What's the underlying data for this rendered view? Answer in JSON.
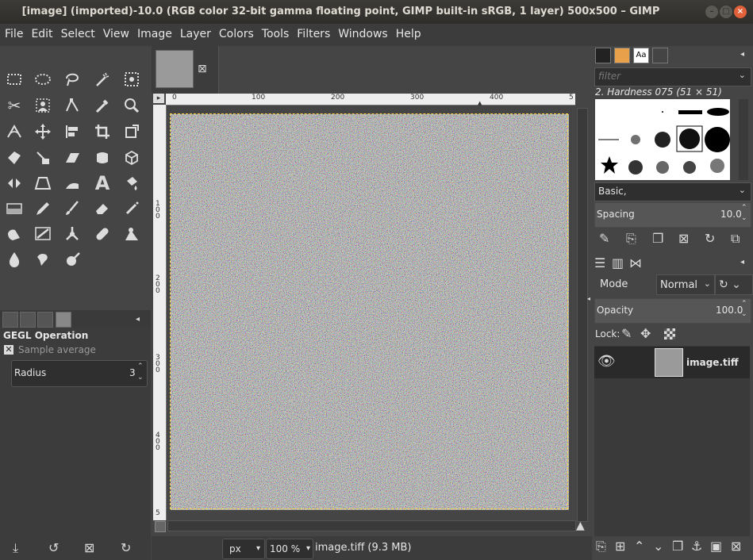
{
  "window": {
    "title": "[image] (imported)-10.0 (RGB color 32-bit gamma floating point, GIMP built-in sRGB, 1 layer) 500x500 – GIMP"
  },
  "menu": [
    "File",
    "Edit",
    "Select",
    "View",
    "Image",
    "Layer",
    "Colors",
    "Tools",
    "Filters",
    "Windows",
    "Help"
  ],
  "tool_options": {
    "title": "GEGL Operation",
    "sample_average_label": "Sample average",
    "radius_label": "Radius",
    "radius_value": "3"
  },
  "rulers": {
    "h_ticks": [
      "0",
      "100",
      "200",
      "300",
      "400",
      "5"
    ],
    "v_ticks": [
      "1",
      "0",
      "0",
      "2",
      "0",
      "0",
      "3",
      "0",
      "0",
      "4",
      "0",
      "0",
      "5"
    ]
  },
  "status": {
    "unit": "px",
    "zoom": "100 %",
    "file_info": "image.tiff (9.3 MB)"
  },
  "brushes": {
    "filter_placeholder": "filter",
    "selected_brush": "2. Hardness 075 (51 × 51)",
    "tag_preset": "Basic,",
    "spacing_label": "Spacing",
    "spacing_value": "10.0"
  },
  "layers": {
    "mode_label": "Mode",
    "mode_value": "Normal",
    "opacity_label": "Opacity",
    "opacity_value": "100.0",
    "lock_label": "Lock:",
    "items": [
      {
        "name": "image.tiff"
      }
    ]
  },
  "colors": {
    "foreground": "#000000",
    "background": "#ffffff",
    "marching_ants": "#ffd84a"
  }
}
